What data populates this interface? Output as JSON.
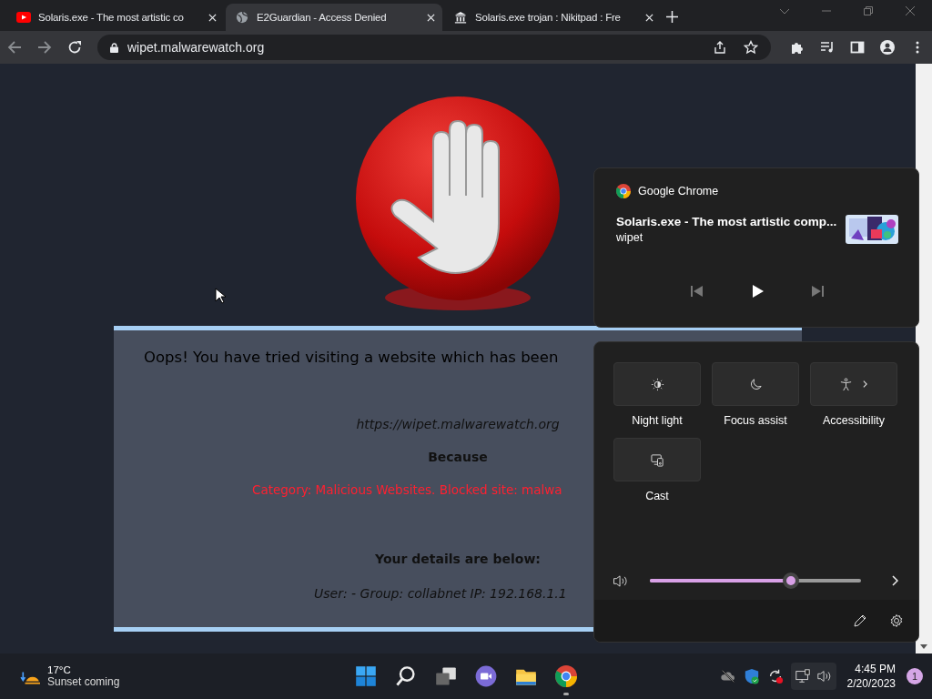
{
  "browser": {
    "tabs": [
      {
        "title": "Solaris.exe - The most artistic co",
        "kind": "video",
        "selected": false
      },
      {
        "title": "E2Guardian - Access Denied",
        "kind": "globe",
        "selected": true
      },
      {
        "title": "Solaris.exe trojan : Nikitpad : Fre",
        "kind": "archive",
        "selected": false
      }
    ],
    "address": "wipet.malwarewatch.org"
  },
  "page": {
    "heading": "Oops! You have tried visiting a website which has been",
    "url": "https://wipet.malwarewatch.org",
    "because": "Because",
    "reason": "Category: Malicious Websites.   Blocked site: malwa",
    "details_heading": "Your details are below:",
    "details": "User: -   Group: collabnet   IP: 192.168.1.1"
  },
  "media": {
    "app": "Google Chrome",
    "title": "Solaris.exe - The most artistic comp...",
    "artist": "wipet"
  },
  "quick_settings": {
    "tiles": [
      {
        "label": "Night light",
        "kind": "night",
        "on": false
      },
      {
        "label": "Focus assist",
        "kind": "moon",
        "on": false
      },
      {
        "label": "Accessibility",
        "kind": "accessibility",
        "on": false
      },
      {
        "label": "Cast",
        "kind": "cast",
        "on": false
      }
    ],
    "volume": {
      "level": 0.67
    }
  },
  "taskbar": {
    "weather": {
      "temp": "17°C",
      "text": "Sunset coming"
    },
    "time": "4:45 PM",
    "date": "2/20/2023",
    "notifications": "1"
  }
}
